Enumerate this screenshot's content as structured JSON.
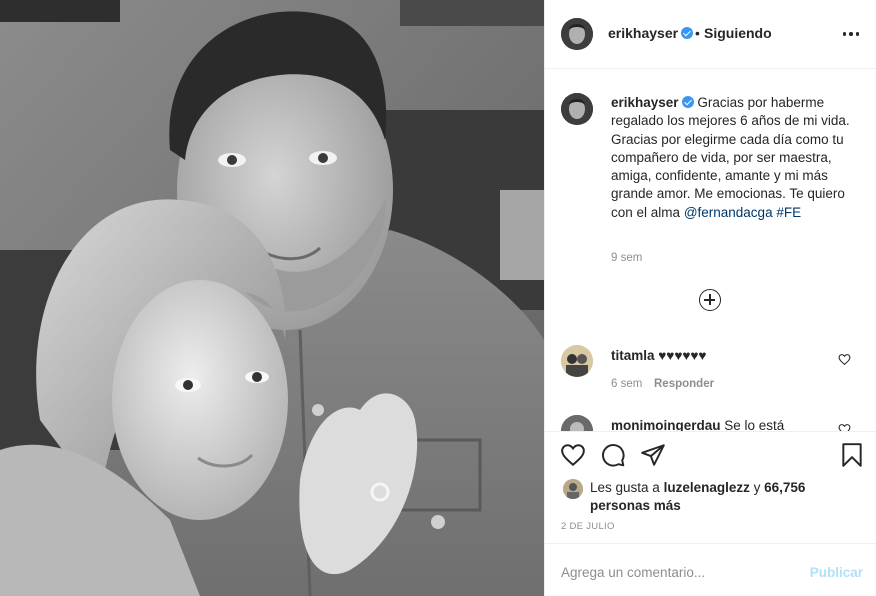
{
  "post": {
    "photo_icon": "couple-selfie-photo"
  },
  "header": {
    "username": "erikhayser",
    "separator": "•",
    "follow_label": "Siguiendo",
    "more_icon": "more-options-icon"
  },
  "caption": {
    "username": "erikhayser",
    "text_before_mention": "Gracias por haberme regalado los mejores 6 años de mi vida. Gracias por elegirme cada día como tu compañero de vida, por ser maestra, amiga, confidente, amante y mi más grande amor. Me emocionas. Te quiero con el alma",
    "mention": "@fernandacga",
    "hashtag": "#FE",
    "time": "9 sem"
  },
  "load_more_icon": "plus-circle-icon",
  "comments": [
    {
      "username": "titamla",
      "text": "♥♥♥♥♥♥",
      "time": "6 sem",
      "reply_label": "Responder"
    },
    {
      "username": "monimoingerdau",
      "text": "Se lo está"
    }
  ],
  "actions": {
    "like_icon": "heart-icon",
    "comment_icon": "comment-icon",
    "share_icon": "share-icon",
    "save_icon": "bookmark-icon"
  },
  "likes": {
    "prefix": "Les gusta a",
    "user": "luzelenaglezz",
    "joiner": "y",
    "count": "66,756 personas más"
  },
  "date": "2 DE JULIO",
  "add_comment": {
    "placeholder": "Agrega un comentario...",
    "post_label": "Publicar"
  },
  "colors": {
    "link": "#00376b",
    "verified": "#3897f0",
    "post_disabled": "#b2dffc",
    "muted": "#8e8e8e"
  }
}
